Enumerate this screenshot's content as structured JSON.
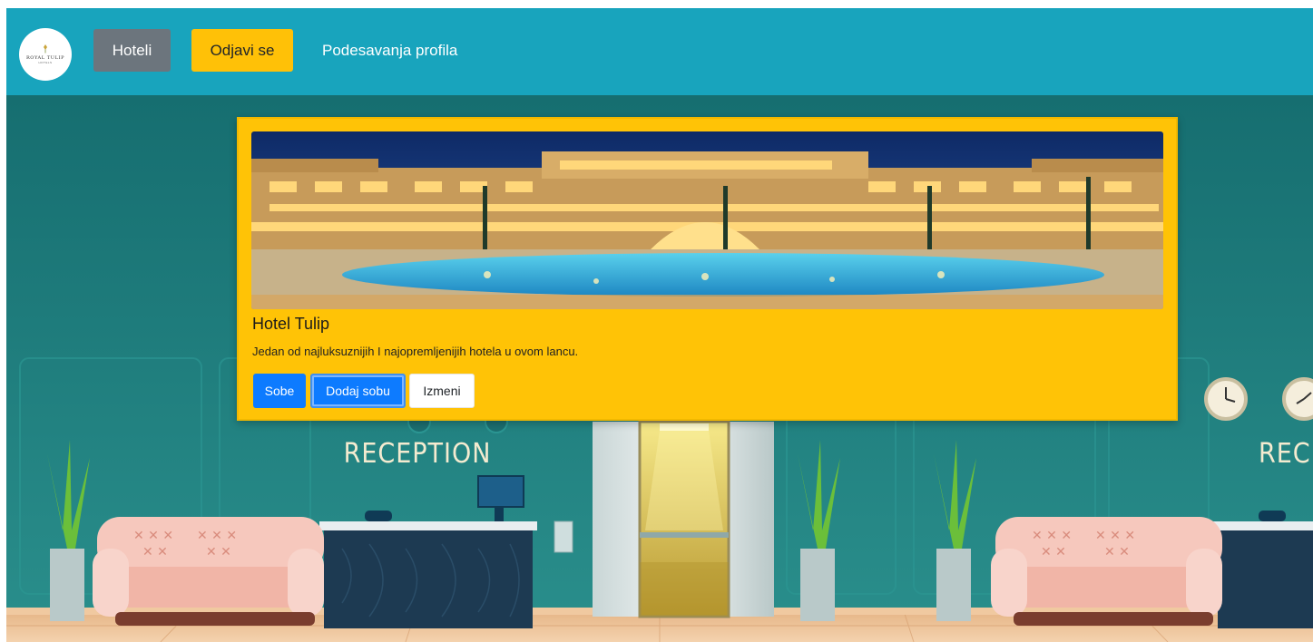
{
  "navbar": {
    "logo": {
      "brand": "ROYAL TULIP",
      "tag": "HOTELS"
    },
    "hoteli_label": "Hoteli",
    "odjavi_label": "Odjavi se",
    "profil_label": "Podesavanja profila"
  },
  "scene": {
    "reception_left": "RECEPTION",
    "reception_right": "RECEPTION"
  },
  "card": {
    "title": "Hotel Tulip",
    "description": "Jedan od najluksuznijih I najopremljenijih hotela u ovom lancu.",
    "buttons": {
      "sobe": "Sobe",
      "dodaj": "Dodaj sobu",
      "izmeni": "Izmeni"
    }
  },
  "colors": {
    "navbar": "#18a4bd",
    "wall": "#1f7f7f",
    "card": "#ffc306",
    "primary": "#0d7bff",
    "secondary": "#6c757d",
    "warning": "#ffc107"
  }
}
